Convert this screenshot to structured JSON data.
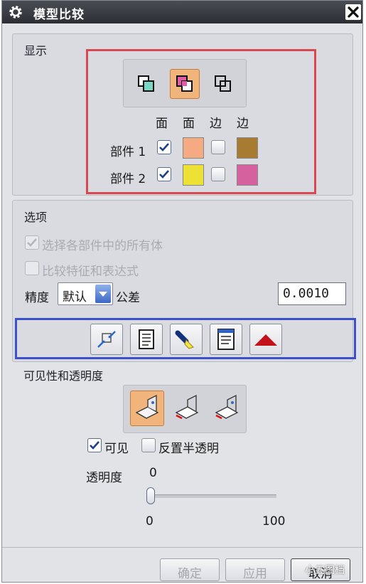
{
  "dialog": {
    "title": "模型比较",
    "close_label": "✕"
  },
  "display": {
    "section_title": "显示",
    "mode_icons": [
      "face-overlay-icon",
      "face-colored-icon",
      "edge-overlay-icon"
    ],
    "col_headers": [
      "面",
      "面",
      "边",
      "边"
    ],
    "rows": [
      {
        "label": "部件 1",
        "face_checked": true,
        "edge_checked": false,
        "face_color": "#f4ab83",
        "edge_color": "#a77b32"
      },
      {
        "label": "部件 2",
        "face_checked": true,
        "edge_checked": false,
        "face_color": "#ede135",
        "edge_color": "#d5619f"
      }
    ]
  },
  "options": {
    "section_title": "选项",
    "select_all_bodies": "选择各部件中的所有体",
    "compare_features": "比较特征和表达式",
    "precision_label": "精度",
    "precision_value": "默认",
    "tolerance_label": "公差",
    "tolerance_value": "0.0010"
  },
  "toolbar": {
    "buttons": [
      "swap-arrows-icon",
      "document-list-icon",
      "flashlight-icon",
      "report-icon",
      "red-triangle-icon"
    ]
  },
  "visibility": {
    "section_title": "可见性和透明度",
    "visible_label": "可见",
    "visible_checked": true,
    "invert_label": "反置半透明",
    "invert_checked": false,
    "transparency_label": "透明度",
    "transparency_value": "0",
    "slider_min": "0",
    "slider_max": "100",
    "slider_level": 0
  },
  "footer": {
    "ok_label": "确定",
    "apply_label": "应用",
    "cancel_label": "取消",
    "watermark": "小五图档"
  },
  "colors": {
    "accent_red": "#d9474f",
    "accent_blue": "#3c4fcf",
    "active_orange": "#f1b47a"
  }
}
